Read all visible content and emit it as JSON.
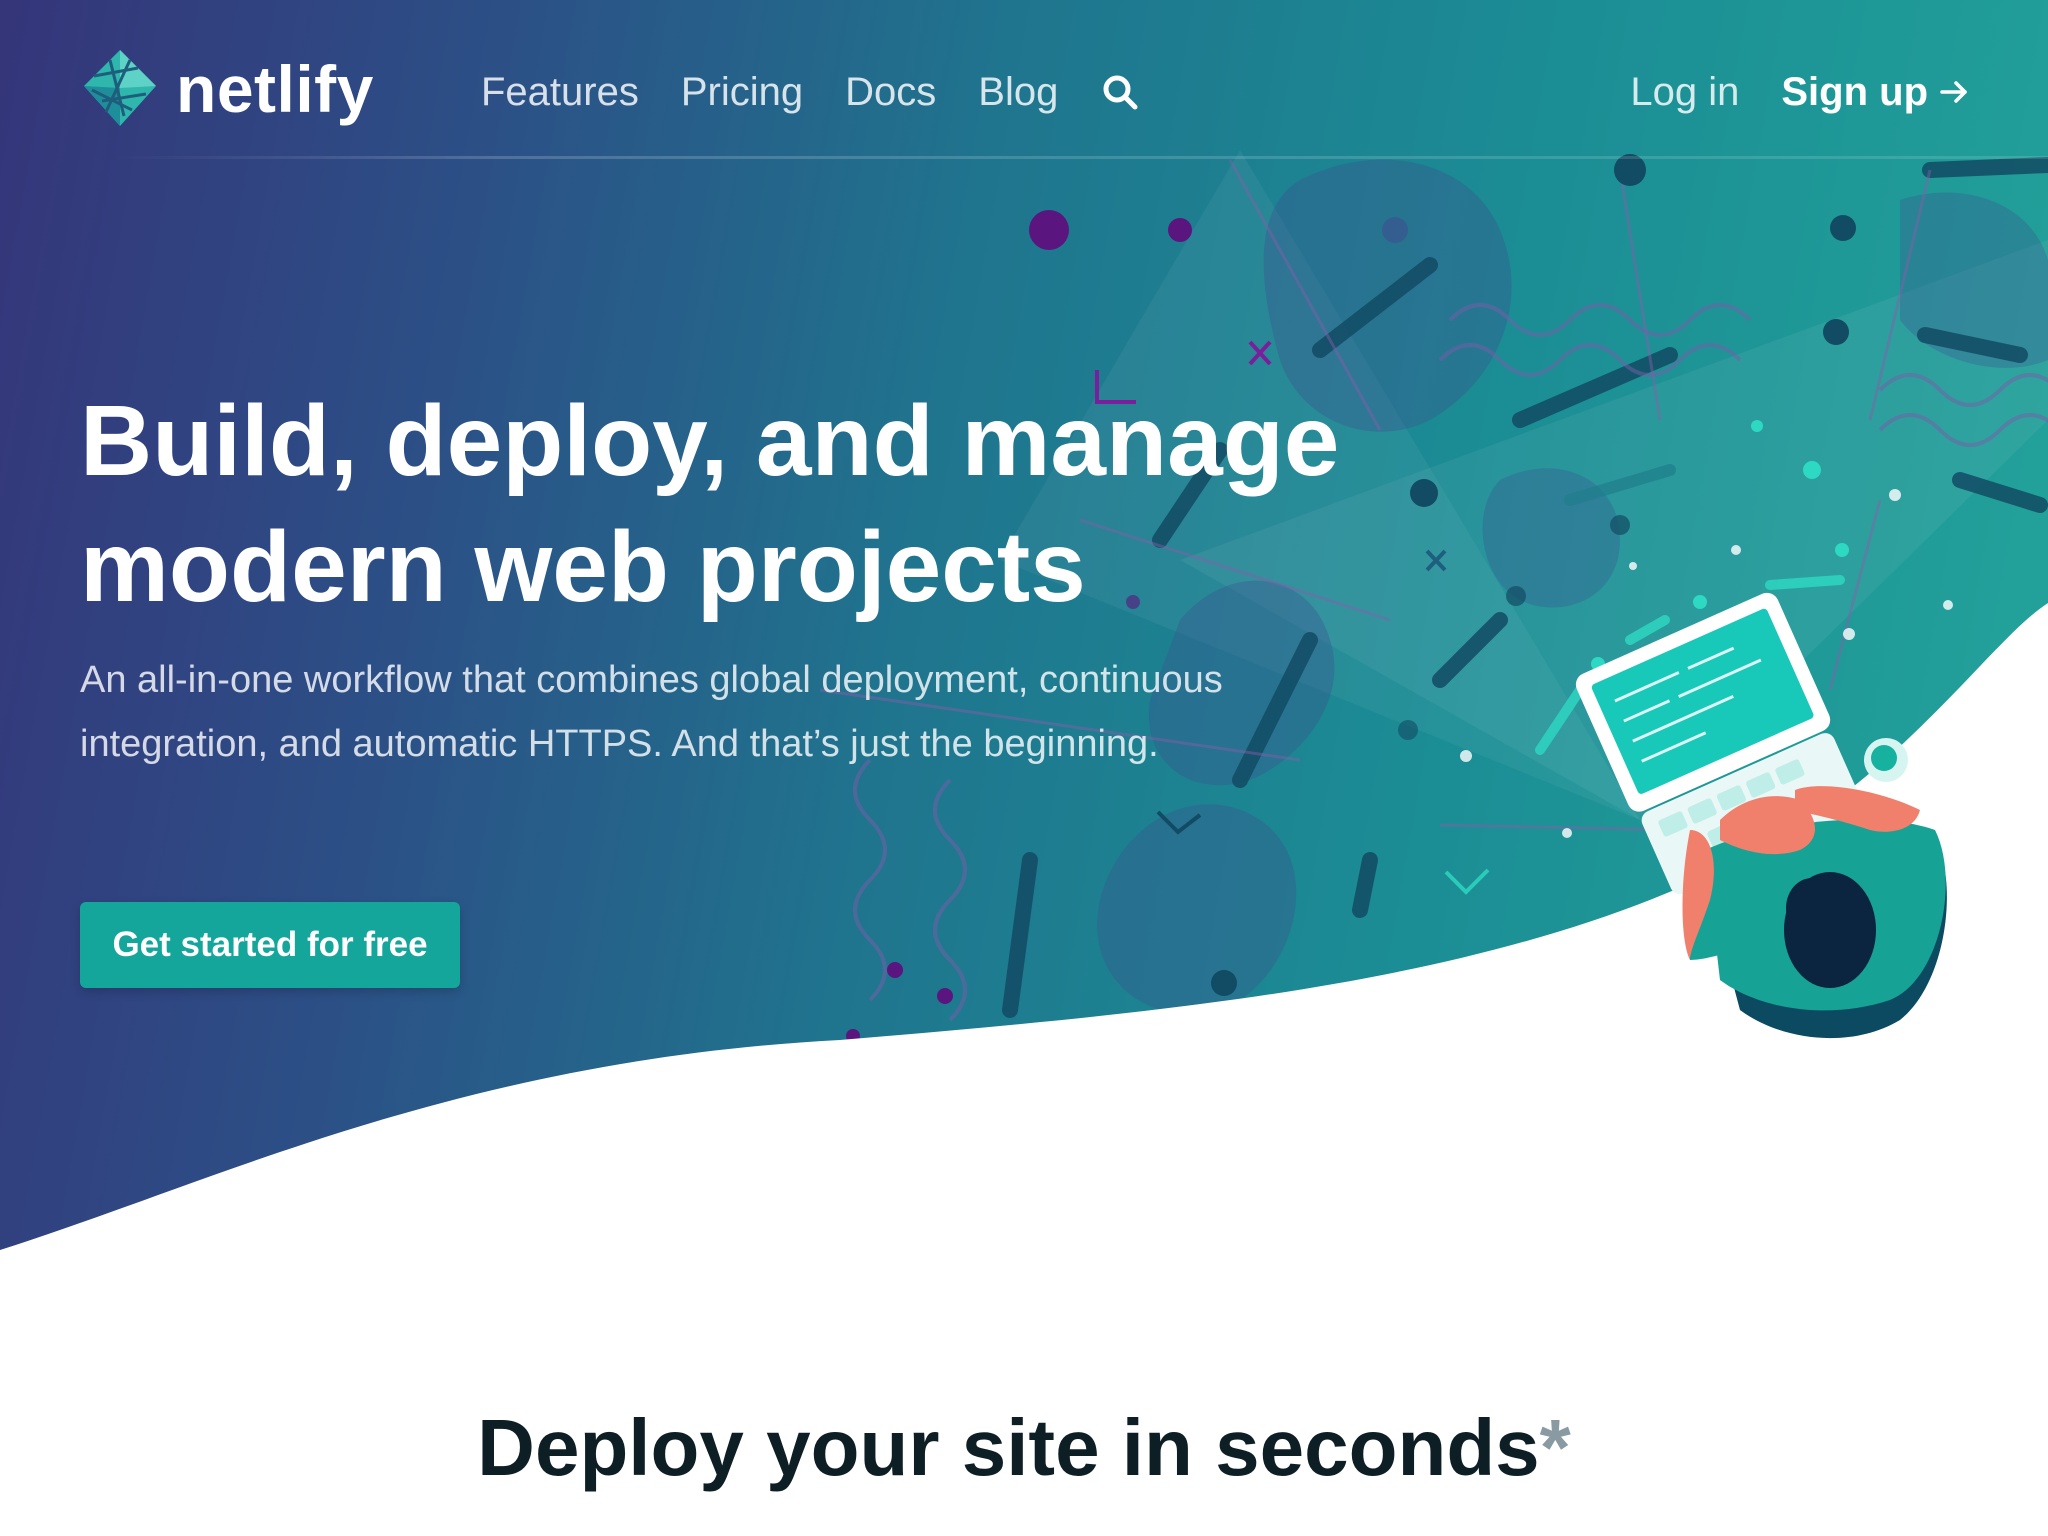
{
  "brand": {
    "name": "netlify"
  },
  "nav": {
    "links": [
      "Features",
      "Pricing",
      "Docs",
      "Blog"
    ],
    "search_icon": "search-icon",
    "login": "Log in",
    "signup": "Sign up",
    "signup_icon": "arrow-right-icon"
  },
  "hero": {
    "title_line1": "Build, deploy, and manage",
    "title_line2": "modern web projects",
    "subtitle": "An all-in-one workflow that combines global deployment, continuous integration, and automatic HTTPS. And that’s just the beginning.",
    "cta": "Get started for free"
  },
  "section": {
    "title": "Deploy your site in seconds",
    "asterisk": "*"
  },
  "colors": {
    "gradient_start": "#35357a",
    "gradient_end": "#24a59b",
    "cta": "#15a69b",
    "title_dark": "#0e1e25"
  }
}
